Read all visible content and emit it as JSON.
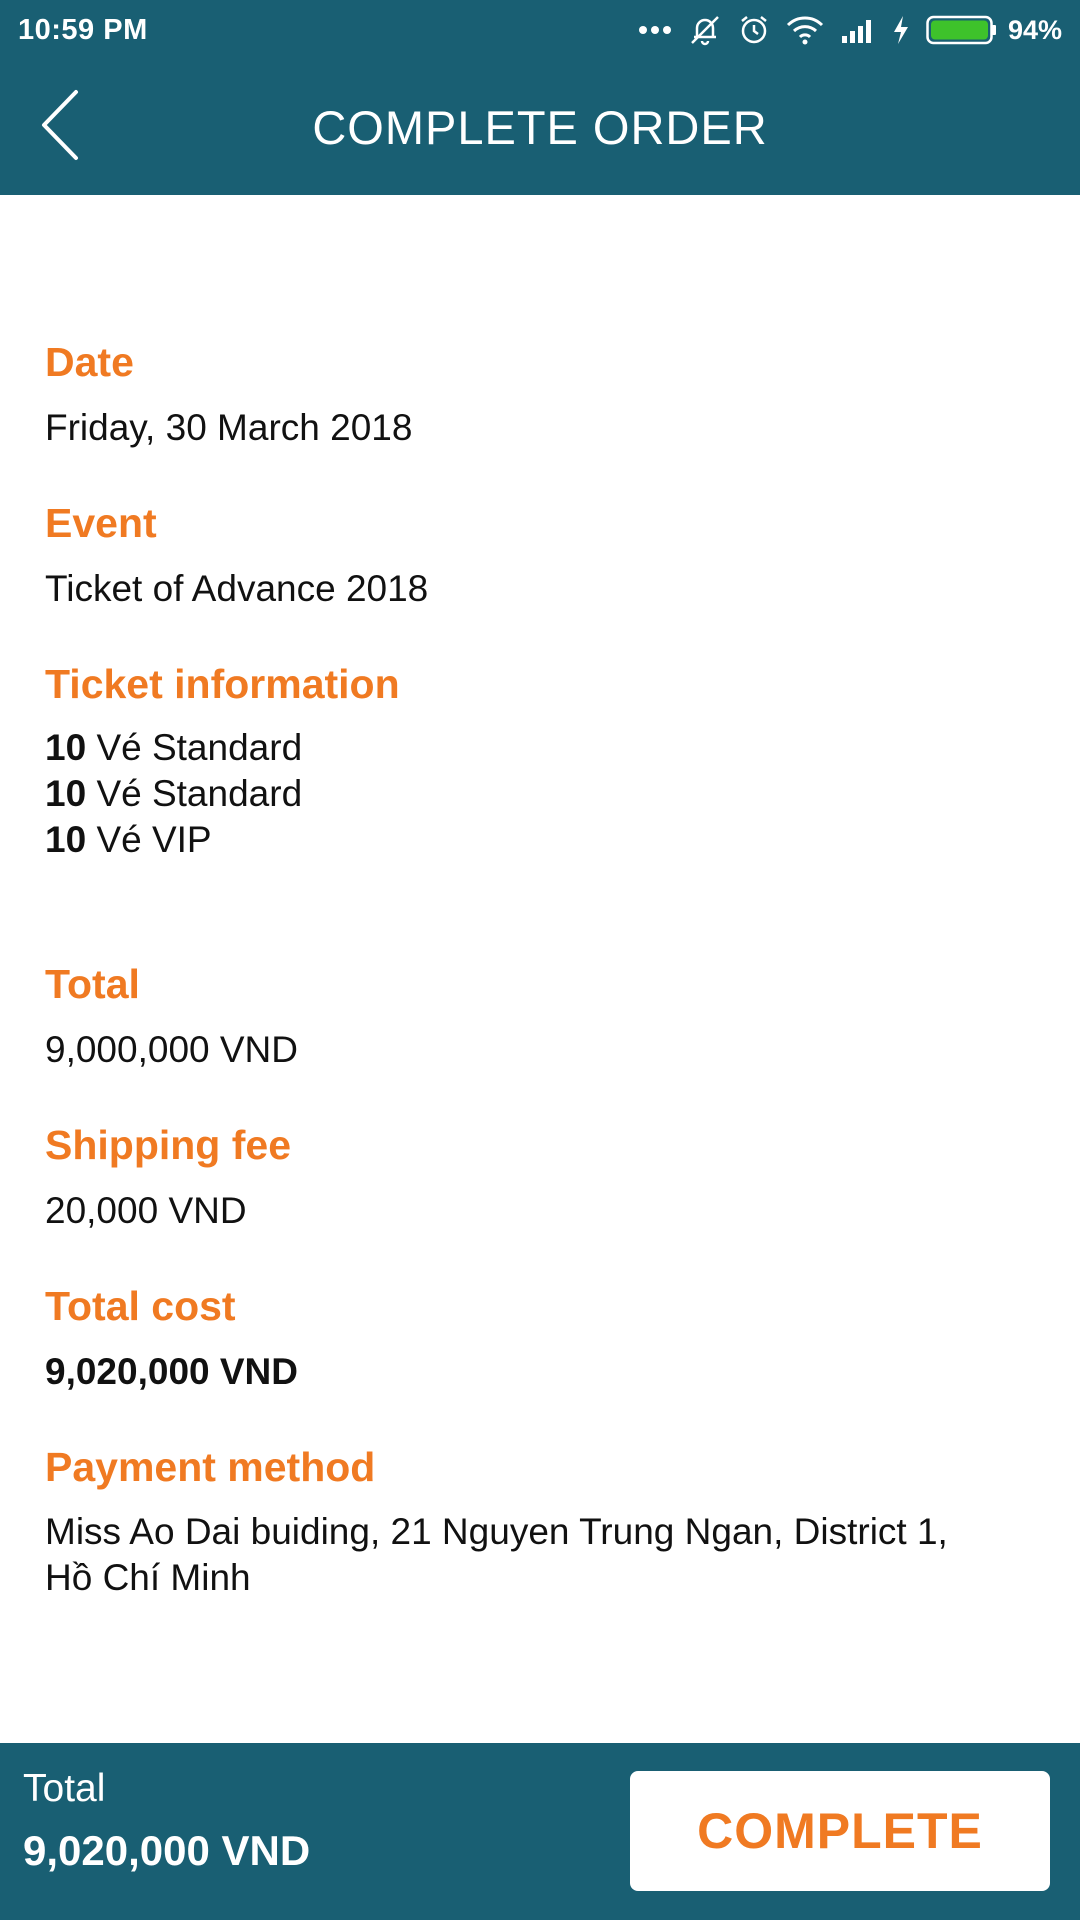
{
  "status_bar": {
    "time": "10:59 PM",
    "battery_percent": "94%",
    "icons": [
      "more-dots-icon",
      "mute-icon",
      "alarm-icon",
      "wifi-icon",
      "signal-icon",
      "charging-icon",
      "battery-icon"
    ],
    "battery_color": "#3ec22b"
  },
  "header": {
    "title": "COMPLETE ORDER",
    "back_icon": "chevron-left-icon"
  },
  "order": {
    "date_label": "Date",
    "date_value": "Friday, 30 March 2018",
    "event_label": "Event",
    "event_value": "Ticket of Advance 2018",
    "tickets_label": "Ticket information",
    "tickets": [
      {
        "qty": "10",
        "name": "Vé Standard"
      },
      {
        "qty": "10",
        "name": "Vé Standard"
      },
      {
        "qty": "10",
        "name": "Vé VIP"
      }
    ],
    "total_label": "Total",
    "total_value": "9,000,000 VND",
    "shipping_label": "Shipping fee",
    "shipping_value": "20,000 VND",
    "total_cost_label": "Total cost",
    "total_cost_value": "9,020,000 VND",
    "payment_label": "Payment method",
    "payment_value_line1": "Miss Ao Dai buiding, 21 Nguyen Trung Ngan, District 1,",
    "payment_value_line2": "Hồ Chí Minh"
  },
  "footer": {
    "total_label": "Total",
    "total_value": "9,020,000 VND",
    "complete_label": "COMPLETE"
  },
  "colors": {
    "primary": "#195f73",
    "accent": "#f07a22",
    "text": "#111111",
    "background": "#ffffff"
  }
}
